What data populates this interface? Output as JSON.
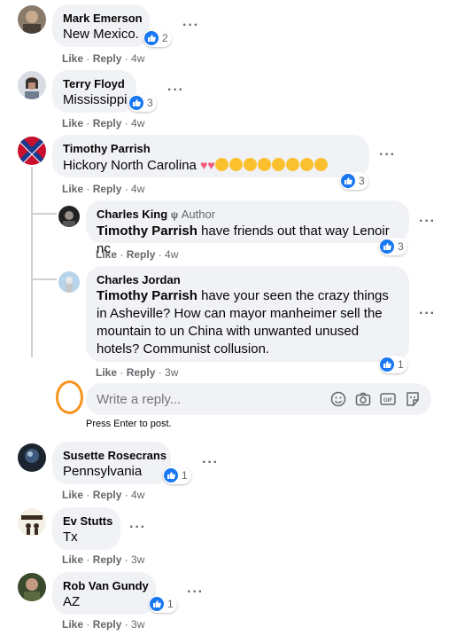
{
  "actions": {
    "like": "Like",
    "reply": "Reply",
    "sep": "·"
  },
  "comments": [
    {
      "author": "Mark Emerson",
      "text": "New Mexico.",
      "reactions": "2",
      "time": "4w"
    },
    {
      "author": "Terry Floyd",
      "text": "Mississippi",
      "reactions": "3",
      "time": "4w"
    },
    {
      "author": "Timothy Parrish",
      "text": "Hickory North Carolina",
      "reactions": "3",
      "time": "4w"
    },
    {
      "author": "Susette Rosecrans",
      "text": "Pennsylvania",
      "reactions": "1",
      "time": "4w"
    },
    {
      "author": "Ev Stutts",
      "text": "Tx",
      "reactions": "",
      "time": "3w"
    },
    {
      "author": "Rob Van Gundy",
      "text": "AZ",
      "reactions": "1",
      "time": "3w"
    }
  ],
  "replies": [
    {
      "author": "Charles King",
      "badge": "Author",
      "mention": "Timothy Parrish",
      "text": "have friends out that way Lenoir nc",
      "reactions": "3",
      "time": "4w"
    },
    {
      "author": "Charles Jordan",
      "mention": "Timothy Parrish",
      "text": "have your seen the crazy things in Asheville? How can mayor manheimer sell the mountain to un China with unwanted unused hotels? Communist collusion.",
      "reactions": "1",
      "time": "3w"
    }
  ],
  "reply_box": {
    "placeholder": "Write a reply...",
    "hint": "Press Enter to post."
  },
  "icons": {
    "like": "thumbs-up-icon",
    "more": "more-options-icon",
    "emoji": "emoji-icon",
    "camera": "camera-icon",
    "gif": "gif-icon",
    "sticker": "sticker-icon"
  },
  "colors": {
    "like_blue": "#1877f2",
    "bubble": "#f0f2f5",
    "meta": "#65676b",
    "orange_ring": "#f7931e"
  }
}
